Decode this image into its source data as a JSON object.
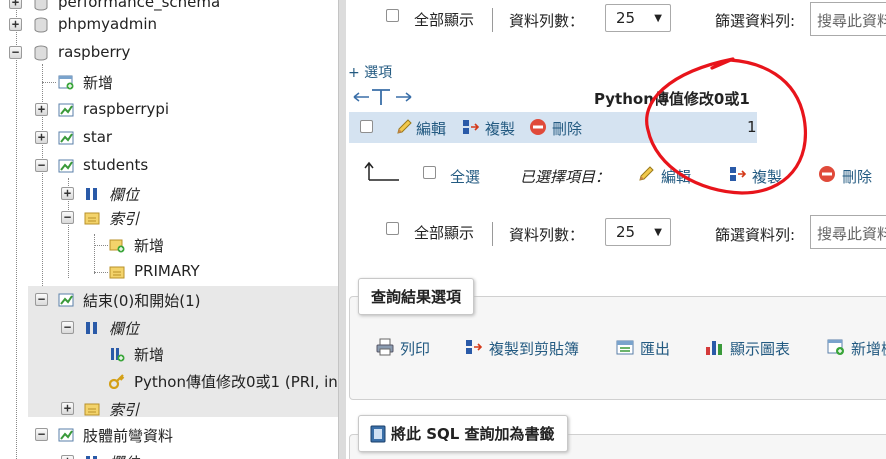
{
  "nav": {
    "items": [
      {
        "label": "performance_schema"
      },
      {
        "label": "phpmyadmin"
      },
      {
        "label": "raspberry"
      },
      {
        "label": "新增"
      },
      {
        "label": "raspberrypi"
      },
      {
        "label": "star"
      },
      {
        "label": "students"
      },
      {
        "label": "欄位"
      },
      {
        "label": "索引"
      },
      {
        "label": "新增"
      },
      {
        "label": "PRIMARY"
      },
      {
        "label": "結束(0)和開始(1)"
      },
      {
        "label": "欄位"
      },
      {
        "label": "新增"
      },
      {
        "label": "Python傳值修改0或1 (PRI, in"
      },
      {
        "label": "索引"
      },
      {
        "label": "肢體前彎資料"
      },
      {
        "label": "欄位"
      }
    ]
  },
  "nav_top": {
    "show_all": "全部顯示",
    "rows_label": "資料列數：",
    "rows_value": "25",
    "filter_label": "篩選資料列:",
    "search_placeholder": "搜尋此資料"
  },
  "options_link": "+ 選項",
  "table": {
    "column_header": "Python傳值修改0或1",
    "row": {
      "edit": "編輯",
      "copy": "複製",
      "delete": "刪除",
      "value": "1"
    }
  },
  "bulk": {
    "check_all": "全選",
    "with_selected": "已選擇項目：",
    "edit": "編輯",
    "copy": "複製",
    "delete": "刪除"
  },
  "nav_bottom": {
    "show_all": "全部顯示",
    "rows_label": "資料列數：",
    "rows_value": "25",
    "filter_label": "篩選資料列:",
    "search_placeholder": "搜尋此資料"
  },
  "query_ops": {
    "legend": "查詢結果選項",
    "print": "列印",
    "copy_clipboard": "複製到剪貼簿",
    "export": "匯出",
    "chart": "顯示圖表",
    "new_view": "新增檢"
  },
  "bookmark": {
    "legend": "將此 SQL 查詢加為書籤"
  },
  "colors": {
    "link": "#235a81",
    "row_bg": "#d5e3f1",
    "annotation": "#e8141b"
  }
}
